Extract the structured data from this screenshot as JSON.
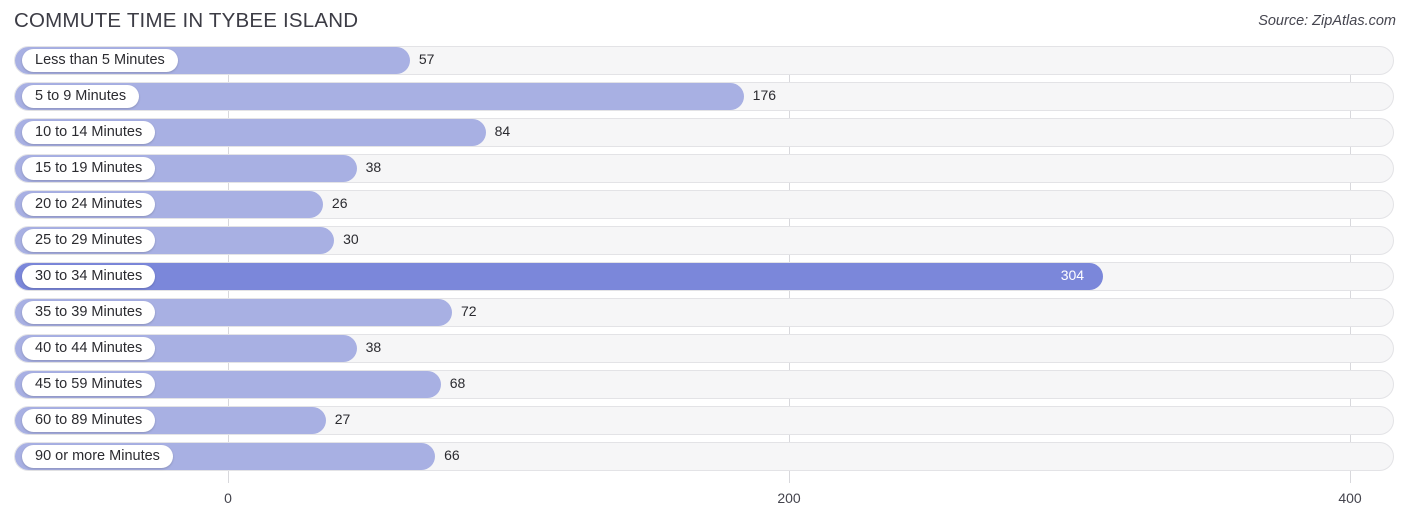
{
  "header": {
    "title": "COMMUTE TIME IN TYBEE ISLAND",
    "source": "Source: ZipAtlas.com"
  },
  "colors": {
    "bar": "#a8b0e3",
    "bar_max": "#7b87da",
    "track": "#f6f6f7",
    "gridline": "#d8d8dc",
    "text": "#2b2b30"
  },
  "chart_data": {
    "type": "bar",
    "orientation": "horizontal",
    "title": "COMMUTE TIME IN TYBEE ISLAND",
    "xlabel": "",
    "ylabel": "",
    "xlim": [
      0,
      400
    ],
    "xticks": [
      0,
      200,
      400
    ],
    "xtick_labels": [
      "0",
      "200",
      "400"
    ],
    "grid": true,
    "legend": false,
    "categories": [
      "Less than 5 Minutes",
      "5 to 9 Minutes",
      "10 to 14 Minutes",
      "15 to 19 Minutes",
      "20 to 24 Minutes",
      "25 to 29 Minutes",
      "30 to 34 Minutes",
      "35 to 39 Minutes",
      "40 to 44 Minutes",
      "45 to 59 Minutes",
      "60 to 89 Minutes",
      "90 or more Minutes"
    ],
    "values": [
      57,
      176,
      84,
      38,
      26,
      30,
      304,
      72,
      38,
      68,
      27,
      66
    ],
    "value_labels": [
      "57",
      "176",
      "84",
      "38",
      "26",
      "30",
      "304",
      "72",
      "38",
      "68",
      "27",
      "66"
    ],
    "max_value": 304,
    "max_index": 6
  }
}
